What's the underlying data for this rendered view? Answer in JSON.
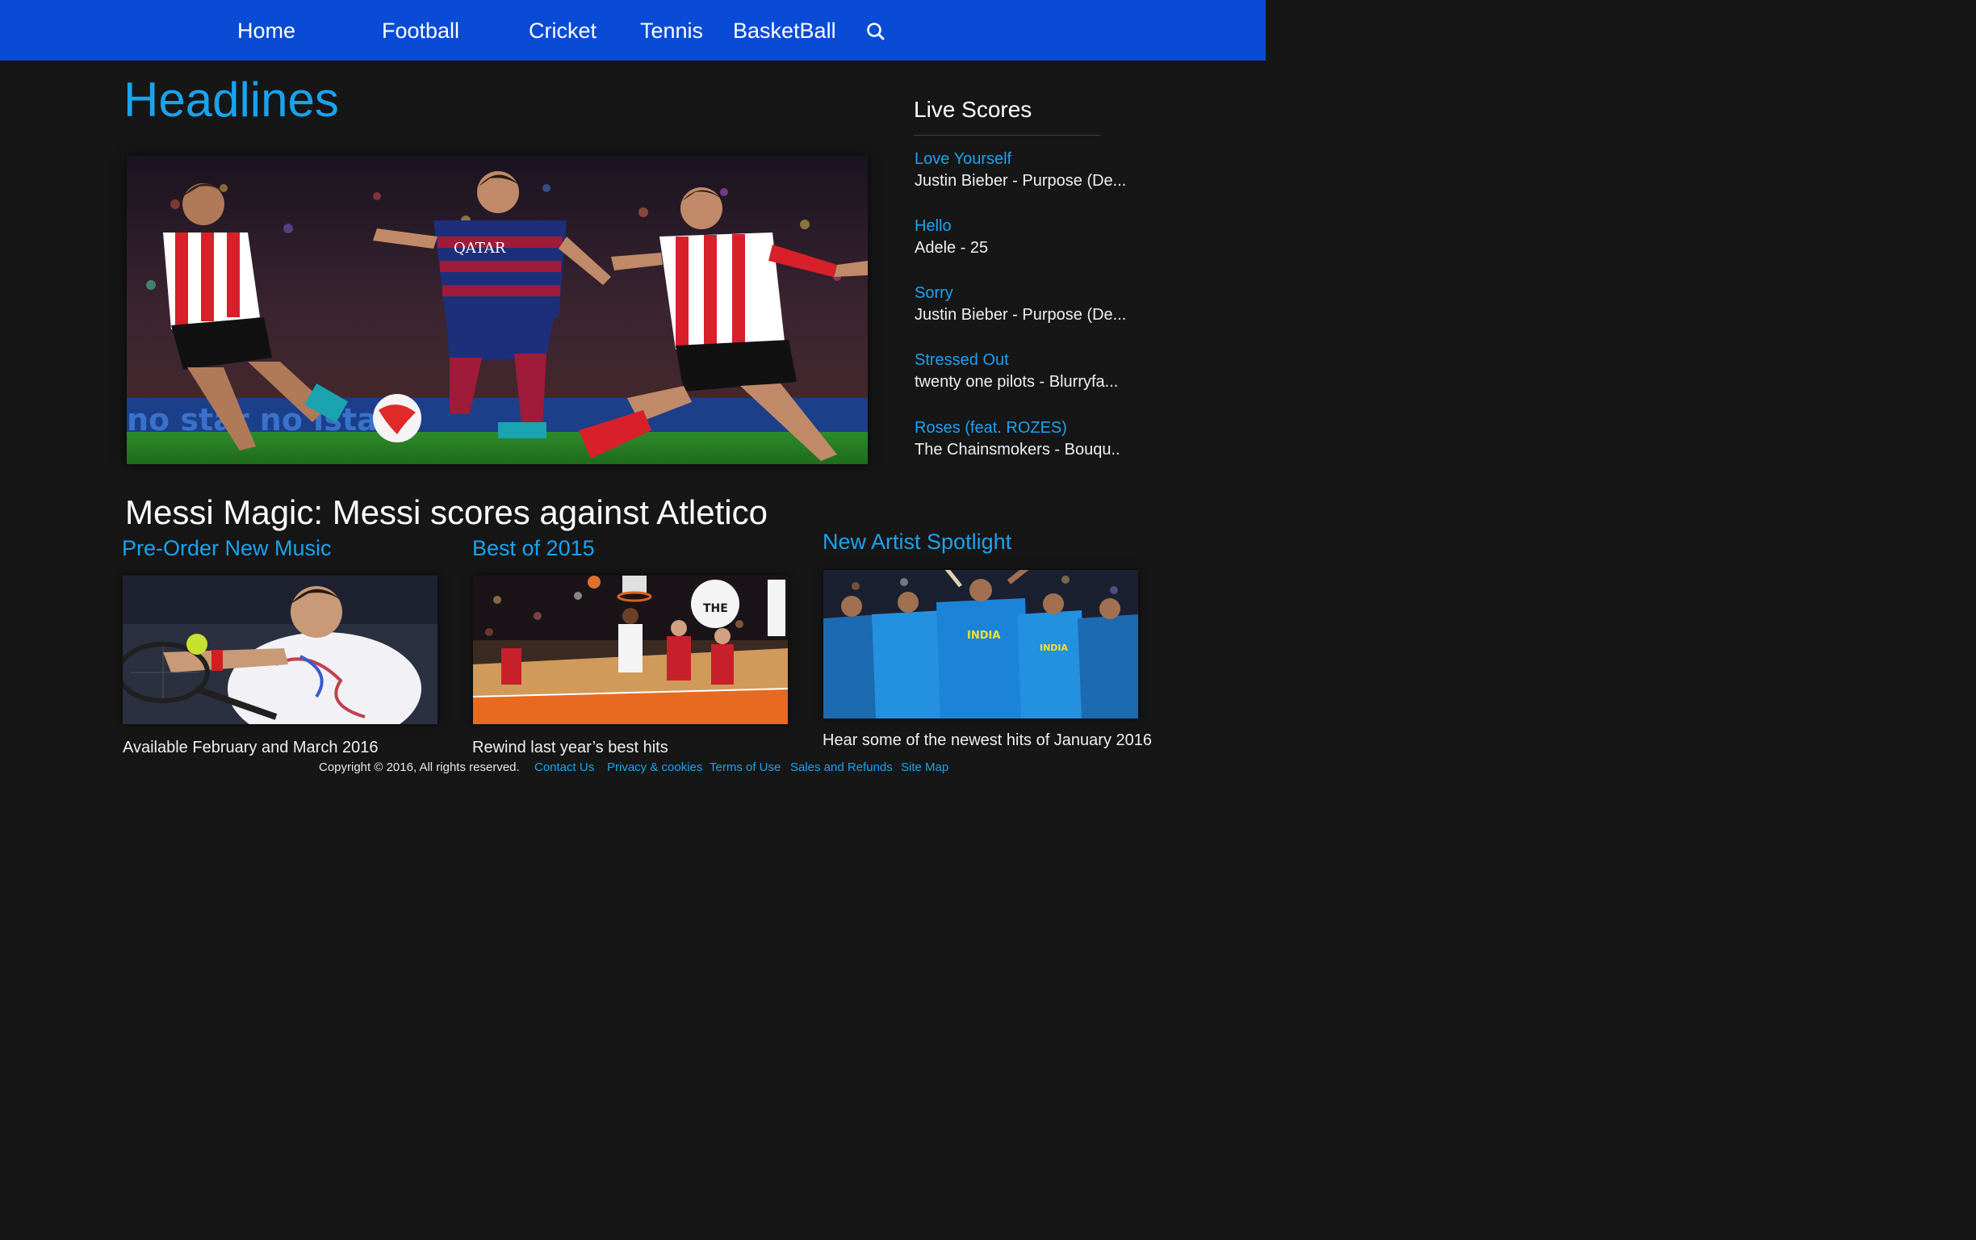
{
  "nav": {
    "items": [
      {
        "label": "Home"
      },
      {
        "label": "Football"
      },
      {
        "label": "Cricket"
      },
      {
        "label": "Tennis"
      },
      {
        "label": "BasketBall"
      }
    ],
    "search_icon": "search-icon",
    "background": "#0a4bd6"
  },
  "headlines": {
    "title": "Headlines",
    "caption": "Messi Magic: Messi scores against Atletico"
  },
  "live_scores": {
    "title": "Live Scores",
    "items": [
      {
        "song": "Love Yourself",
        "artist": "Justin Bieber - Purpose (De..."
      },
      {
        "song": "Hello",
        "artist": "Adele - 25"
      },
      {
        "song": "Sorry",
        "artist": "Justin Bieber - Purpose (De..."
      },
      {
        "song": "Stressed Out",
        "artist": "twenty one pilots - Blurryfa..."
      },
      {
        "song": "Roses (feat. ROZES)",
        "artist": "The Chainsmokers - Bouqu.."
      }
    ]
  },
  "sections": [
    {
      "title": "Pre-Order New Music",
      "description": "Available February and March 2016"
    },
    {
      "title": "Best of 2015",
      "description": "Rewind last year’s best hits"
    },
    {
      "title": "New Artist Spotlight",
      "description": "Hear some of the newest hits of January 2016"
    }
  ],
  "footer": {
    "copyright": "Copyright © 2016, All rights reserved.",
    "links": [
      "Contact Us",
      "Privacy & cookies",
      "Terms of Use",
      "Sales and Refunds",
      "Site Map"
    ]
  },
  "colors": {
    "accent": "#1aa3f0",
    "page_background": "#161616",
    "text": "#ffffff"
  }
}
